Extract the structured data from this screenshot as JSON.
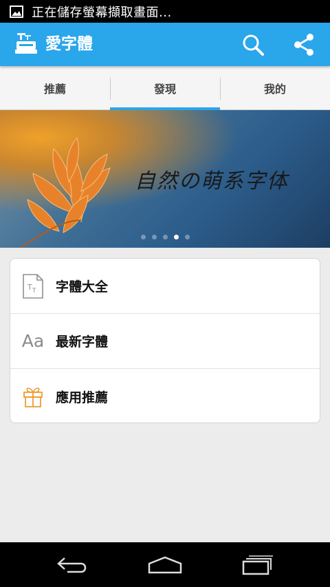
{
  "status_bar": {
    "notification_text": "正在儲存螢幕擷取畫面...",
    "icon": "image-icon"
  },
  "app_bar": {
    "title": "愛字體",
    "logo_icon": "app-logo-icon",
    "actions": [
      {
        "icon": "search-icon"
      },
      {
        "icon": "share-icon"
      }
    ],
    "color": "#2aa6ea"
  },
  "tabs": [
    {
      "label": "推薦",
      "active": false
    },
    {
      "label": "發現",
      "active": true
    },
    {
      "label": "我的",
      "active": false
    }
  ],
  "banner": {
    "text": "自然の萌系字体",
    "page_count": 5,
    "active_page": 4
  },
  "menu": [
    {
      "label": "字體大全",
      "icon": "font-file-icon"
    },
    {
      "label": "最新字體",
      "icon": "aa-font-icon",
      "icon_text": "Aa"
    },
    {
      "label": "應用推薦",
      "icon": "gift-icon"
    }
  ],
  "nav_bar": [
    {
      "icon": "back-icon"
    },
    {
      "icon": "home-icon"
    },
    {
      "icon": "recent-apps-icon"
    }
  ]
}
